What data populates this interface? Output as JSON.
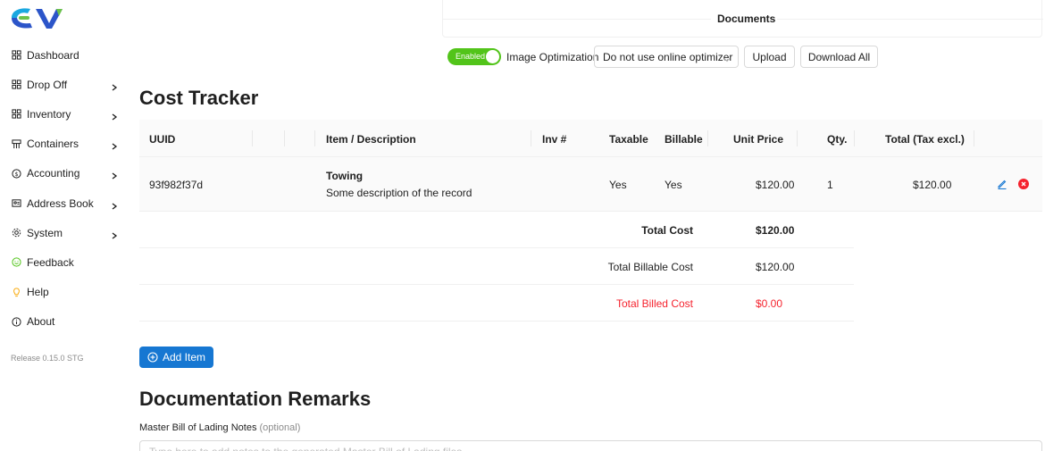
{
  "brand": {
    "logo_colors": [
      "#1aa8e0",
      "#2c55c9",
      "#6cc24a"
    ]
  },
  "sidebar": {
    "items": [
      {
        "label": "Dashboard",
        "icon": "grid-icon",
        "has_submenu": false
      },
      {
        "label": "Drop Off",
        "icon": "grid-icon",
        "has_submenu": true
      },
      {
        "label": "Inventory",
        "icon": "grid-icon",
        "has_submenu": true
      },
      {
        "label": "Containers",
        "icon": "container-icon",
        "has_submenu": true
      },
      {
        "label": "Accounting",
        "icon": "dollar-icon",
        "has_submenu": true
      },
      {
        "label": "Address Book",
        "icon": "contact-card-icon",
        "has_submenu": true
      },
      {
        "label": "System",
        "icon": "gear-icon",
        "has_submenu": true
      },
      {
        "label": "Feedback",
        "icon": "smile-icon",
        "has_submenu": false
      },
      {
        "label": "Help",
        "icon": "bulb-icon",
        "has_submenu": false
      },
      {
        "label": "About",
        "icon": "info-icon",
        "has_submenu": false
      }
    ],
    "release": "Release 0.15.0 STG"
  },
  "documents": {
    "title": "Documents",
    "switch_label": "Enabled",
    "image_optimization_label": "Image Optimization",
    "optimizer_selected": "Do not use online optimizer",
    "upload_label": "Upload",
    "download_all_label": "Download All"
  },
  "cost_tracker": {
    "title": "Cost Tracker",
    "columns": {
      "uuid": "UUID",
      "item": "Item / Description",
      "inv": "Inv #",
      "taxable": "Taxable",
      "billable": "Billable",
      "unit_price": "Unit Price",
      "qty": "Qty.",
      "total": "Total (Tax excl.)"
    },
    "rows": [
      {
        "uuid": "93f982f37d",
        "item": "Towing",
        "description": "Some description of the record",
        "inv": "",
        "taxable": "Yes",
        "billable": "Yes",
        "unit_price": "$120.00",
        "qty": "1",
        "total": "$120.00"
      }
    ],
    "summary": [
      {
        "label": "Total Cost",
        "value": "$120.00",
        "bold": true,
        "color": "#1f1f1f"
      },
      {
        "label": "Total Billable Cost",
        "value": "$120.00",
        "bold": false,
        "color": "#1f1f1f"
      },
      {
        "label": "Total Billed Cost",
        "value": "$0.00",
        "bold": false,
        "color": "#f5222d"
      }
    ],
    "add_item_label": "Add Item"
  },
  "remarks": {
    "title": "Documentation Remarks",
    "mbl_label": "Master Bill of Lading Notes",
    "mbl_optional": "(optional)",
    "mbl_placeholder": "Type here to add notes to the generated Master Bill of Lading files",
    "mbl_value": ""
  },
  "colors": {
    "primary": "#1677d2",
    "success": "#52c41a",
    "danger": "#f5222d",
    "edit_icon": "#1677d2"
  }
}
